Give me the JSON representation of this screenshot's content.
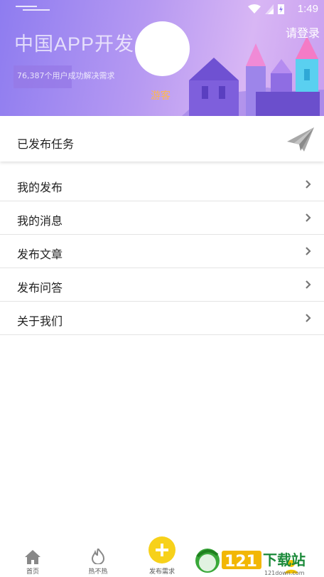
{
  "status_bar": {
    "time": "1:49"
  },
  "banner": {
    "title": "中国APP开发",
    "subtitle": "76,387个用户成功解决需求",
    "login_link": "请登录",
    "guest_label": "游客"
  },
  "published_tasks": {
    "label": "已发布任务",
    "icon": "paper-plane-icon"
  },
  "menu": {
    "items": [
      {
        "label": "我的发布"
      },
      {
        "label": "我的消息"
      },
      {
        "label": "发布文章"
      },
      {
        "label": "发布问答"
      },
      {
        "label": "关于我们"
      }
    ]
  },
  "tabbar": {
    "home": "首页",
    "hot": "热不热",
    "post": "发布需求"
  },
  "colors": {
    "accent_yellow": "#f7d11a",
    "banner_purple": "#8e7cf0",
    "guest_orange": "#ffb84d"
  },
  "watermark": {
    "text": "121下载站",
    "domain": "121down.com"
  }
}
